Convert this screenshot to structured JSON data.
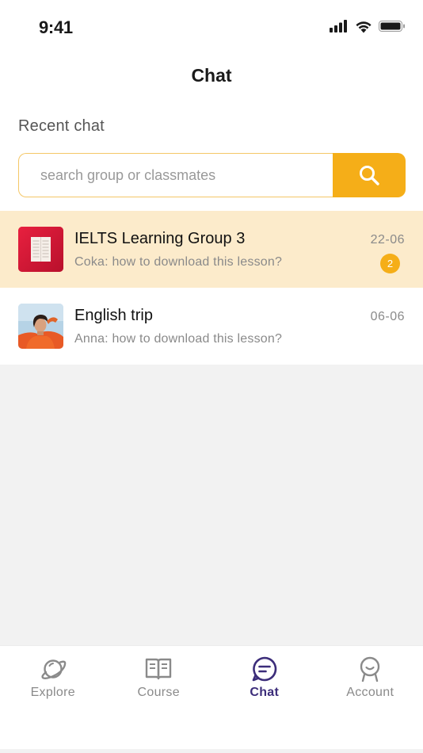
{
  "status_bar": {
    "time": "9:41",
    "icons": [
      "signal-icon",
      "wifi-icon",
      "battery-icon"
    ]
  },
  "header": {
    "title": "Chat"
  },
  "section": {
    "title": "Recent chat"
  },
  "search": {
    "placeholder": "search group or classmates",
    "value": "",
    "button_icon": "search-icon"
  },
  "chats": [
    {
      "name": "IELTS Learning Group 3",
      "preview": "Coka: how to download this lesson?",
      "date": "22-06",
      "unread": "2",
      "highlighted": true,
      "avatar": "book-thumbnail"
    },
    {
      "name": "English trip",
      "preview": "Anna: how to download this lesson?",
      "date": "06-06",
      "unread": "",
      "highlighted": false,
      "avatar": "person-photo"
    }
  ],
  "tabs": [
    {
      "label": "Explore",
      "icon": "planet-icon",
      "active": false
    },
    {
      "label": "Course",
      "icon": "book-icon",
      "active": false
    },
    {
      "label": "Chat",
      "icon": "chat-bubble-icon",
      "active": true
    },
    {
      "label": "Account",
      "icon": "user-icon",
      "active": false
    }
  ],
  "colors": {
    "accent": "#f5ae18",
    "highlight_row": "#fcebcb",
    "active_tab": "#3c2d7a",
    "inactive": "#8a8a8a"
  }
}
